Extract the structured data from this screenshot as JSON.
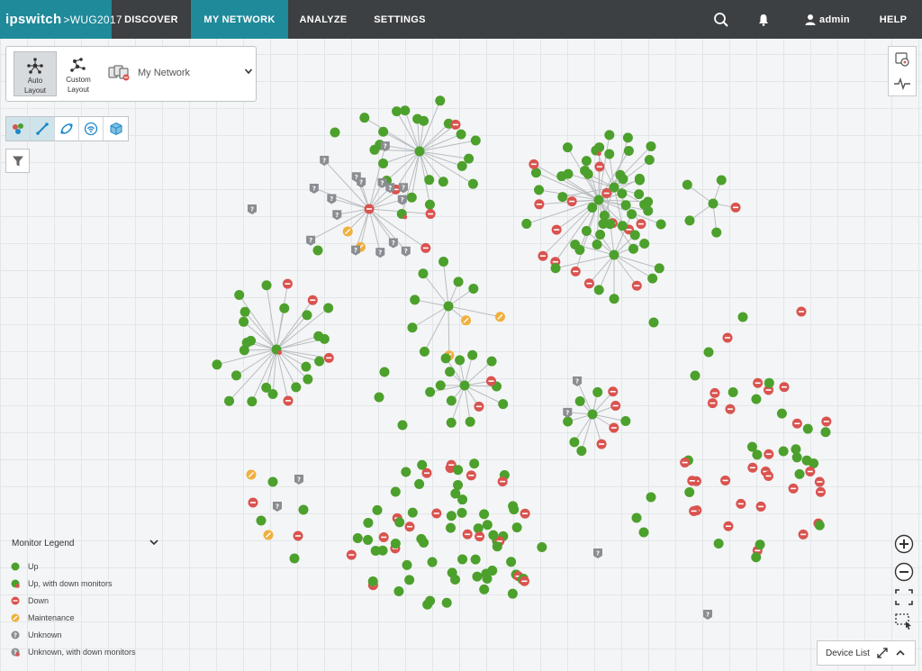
{
  "brand": {
    "name": "ipswitch",
    "product": ">WUG2017"
  },
  "nav": {
    "discover": "DISCOVER",
    "my_network": "MY NETWORK",
    "analyze": "ANALYZE",
    "settings": "SETTINGS"
  },
  "topbar": {
    "user": "admin",
    "help": "HELP"
  },
  "layout": {
    "auto": [
      "Auto",
      "Layout"
    ],
    "custom": [
      "Custom",
      "Layout"
    ],
    "group": "My Network"
  },
  "legend": {
    "title": "Monitor Legend",
    "items": [
      "Up",
      "Up, with down monitors",
      "Down",
      "Maintenance",
      "Unknown",
      "Unknown, with down monitors"
    ]
  },
  "device_list": "Device List",
  "colors": {
    "up": "#4ca02c",
    "down": "#d9534f",
    "maintenance": "#f0b03d",
    "unknown": "#8a8d91",
    "header": "#3c4043",
    "accent": "#1f8a9a"
  },
  "icons": [
    "search-icon",
    "bell-icon",
    "user-icon",
    "chevron-down-icon",
    "filter-icon",
    "device-properties-icon",
    "activity-icon",
    "zoom-in-icon",
    "zoom-out-icon",
    "fit-to-screen-icon",
    "select-region-icon",
    "expand-icon",
    "chevron-up-icon"
  ]
}
